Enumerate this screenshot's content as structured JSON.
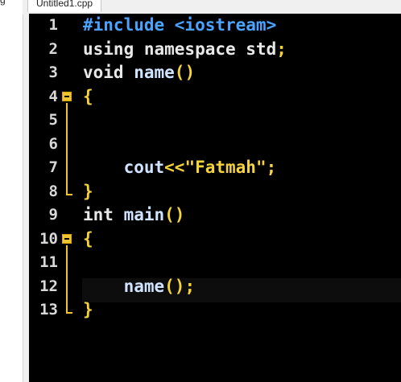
{
  "left_tab": {
    "label": "g"
  },
  "tab": {
    "title": "Untitled1.cpp"
  },
  "editor": {
    "lines": [
      {
        "num": "1",
        "tokens": [
          {
            "t": "#include <iostream>",
            "c": "pp"
          }
        ]
      },
      {
        "num": "2",
        "tokens": [
          {
            "t": "using namespace std",
            "c": "kw"
          },
          {
            "t": ";",
            "c": "pu"
          }
        ]
      },
      {
        "num": "3",
        "tokens": [
          {
            "t": "void ",
            "c": "ty"
          },
          {
            "t": "name",
            "c": "fn"
          },
          {
            "t": "()",
            "c": "br"
          }
        ]
      },
      {
        "num": "4",
        "tokens": [
          {
            "t": "{",
            "c": "br"
          }
        ]
      },
      {
        "num": "5",
        "tokens": []
      },
      {
        "num": "6",
        "tokens": []
      },
      {
        "num": "7",
        "tokens": [
          {
            "t": "    cout",
            "c": "id"
          },
          {
            "t": "<<",
            "c": "pu"
          },
          {
            "t": "\"Fatmah\"",
            "c": "str"
          },
          {
            "t": ";",
            "c": "pu"
          }
        ]
      },
      {
        "num": "8",
        "tokens": [
          {
            "t": "}",
            "c": "br"
          }
        ]
      },
      {
        "num": "9",
        "tokens": [
          {
            "t": "int ",
            "c": "ty"
          },
          {
            "t": "main",
            "c": "fn"
          },
          {
            "t": "()",
            "c": "br"
          }
        ]
      },
      {
        "num": "10",
        "tokens": [
          {
            "t": "{",
            "c": "br"
          }
        ]
      },
      {
        "num": "11",
        "tokens": []
      },
      {
        "num": "12",
        "tokens": [
          {
            "t": "    name",
            "c": "fn"
          },
          {
            "t": "();",
            "c": "pu"
          }
        ]
      },
      {
        "num": "13",
        "tokens": [
          {
            "t": "}",
            "c": "br"
          }
        ]
      }
    ],
    "current_line": 12
  },
  "colors": {
    "editor_bg": "#000000",
    "line_number": "#d8d8d8",
    "preprocessor": "#4aa3ff",
    "bracket": "#f5d33b",
    "string": "#f5d33b",
    "fold_marker": "#f2c431"
  }
}
